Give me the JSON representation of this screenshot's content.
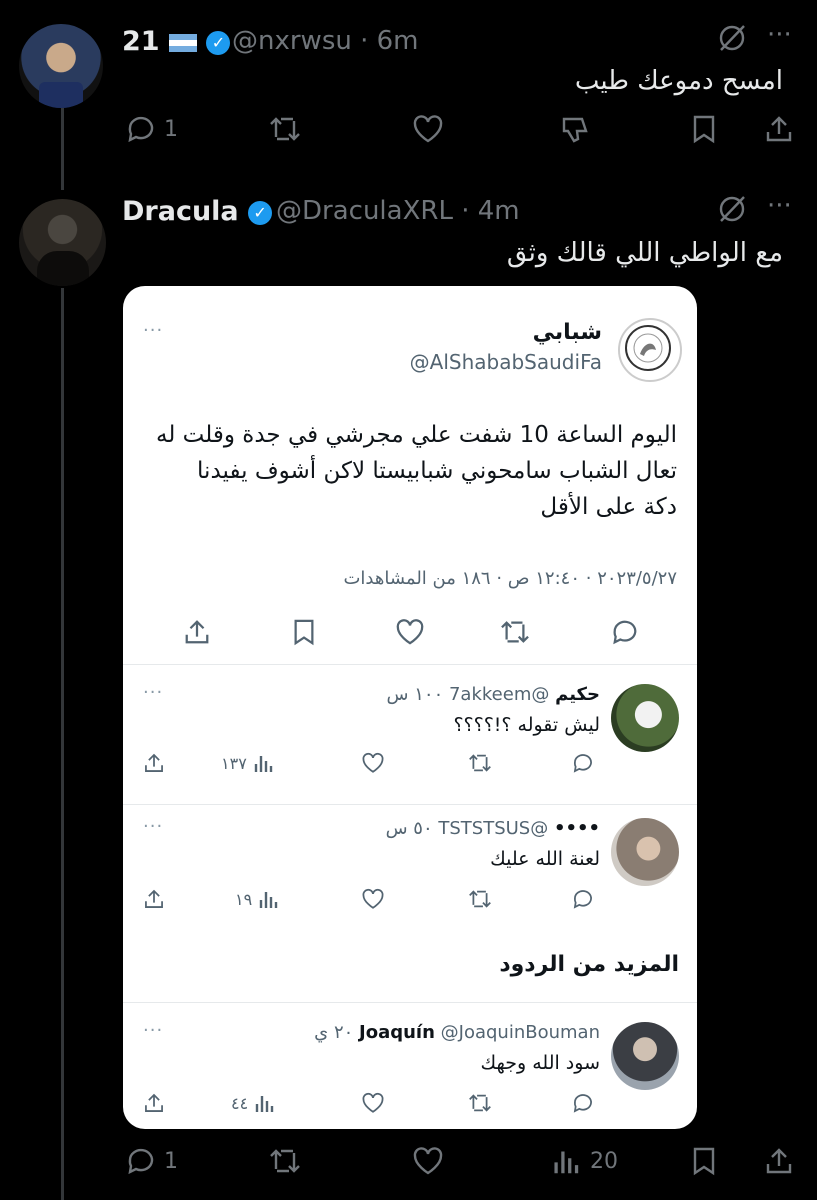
{
  "reply1": {
    "name": "21",
    "handle": "@nxrwsu",
    "time": "6m",
    "text": "امسح دموعك طيب",
    "replies": "1",
    "colors": {
      "background": "#000000",
      "muted": "#71767b",
      "verified": "#1d9bf0"
    }
  },
  "reply2": {
    "name": "Dracula",
    "handle": "@DraculaXRL",
    "time": "4m",
    "text": "مع الواطي اللي قالك وثق",
    "replies": "1",
    "views": "20"
  },
  "embed": {
    "main": {
      "name": "شبابي",
      "handle": "@AlShababSaudiFa",
      "line1": "اليوم الساعة 10 شفت علي مجرشي في جدة وقلت له",
      "line2": "تعال الشباب سامحوني شبابيستا لاكن أشوف يفيدنا",
      "line3": "دكة على الأقل",
      "meta": "٢٠٢٣/٥/٢٧ · ١٢:٤٠ ص · ١٨٦ من المشاهدات",
      "more": "···"
    },
    "replies": [
      {
        "name": "حكيم",
        "handle": "@7akkeem",
        "time": "١٠٠ س",
        "text": "ليش تقوله ؟!؟؟؟؟",
        "views": "١٣٧",
        "more": "···"
      },
      {
        "name": "••••",
        "handle": "@TSTSTSUS",
        "time": "٥٠ س",
        "text": "لعنة الله عليك",
        "views": "١٩",
        "more": "···"
      }
    ],
    "more_replies_heading": "المزيد من الردود",
    "reply3": {
      "name": "Joaquín",
      "handle": "@JoaquinBouman",
      "time": "٢٠ ي",
      "text": "سود الله وجهك",
      "views": "٤٤",
      "more": "···"
    }
  },
  "icons": [
    "reply-icon",
    "retweet-icon",
    "like-icon",
    "dislike-icon",
    "bookmark-icon",
    "share-icon",
    "views-icon",
    "grok-icon",
    "more-icon",
    "verified-icon",
    "flag-icon"
  ]
}
